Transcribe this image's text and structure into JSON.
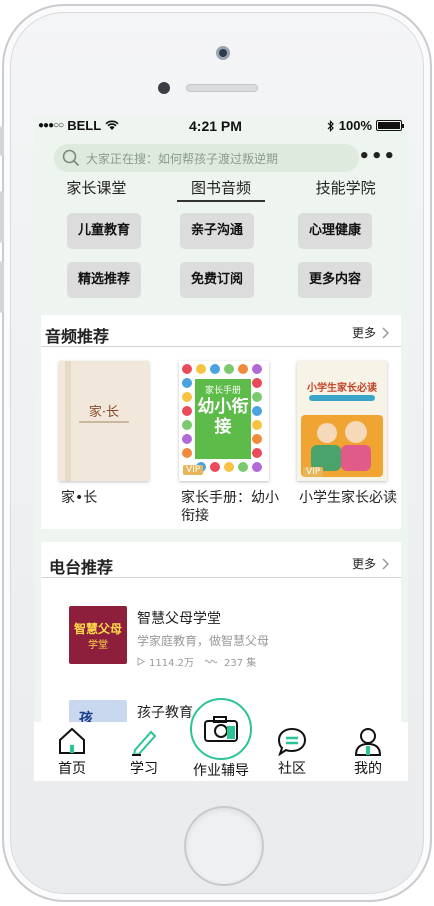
{
  "status_bar": {
    "carrier": "BELL",
    "time": "4:21 PM",
    "battery": "100%"
  },
  "search": {
    "placeholder": "大家正在搜：如何帮孩子渡过叛逆期"
  },
  "top_tabs": [
    {
      "label": "家长课堂",
      "active": false
    },
    {
      "label": "图书音频",
      "active": true
    },
    {
      "label": "技能学院",
      "active": false
    }
  ],
  "categories": [
    "儿童教育",
    "亲子沟通",
    "心理健康",
    "精选推荐",
    "免费订阅",
    "更多内容"
  ],
  "audio_section": {
    "title": "音频推荐",
    "more_label": "更多",
    "books": [
      {
        "title": "家•长",
        "cover_text": "家·长",
        "vip": false
      },
      {
        "title": "家长手册：幼小衔接",
        "cover_text_top": "家长手册",
        "cover_text_main": "幼小衔接",
        "vip": true,
        "vip_label": "VIP"
      },
      {
        "title": "小学生家长必读",
        "cover_text": "小学生家长必读",
        "vip": true,
        "vip_label": "VIP"
      }
    ]
  },
  "radio_section": {
    "title": "电台推荐",
    "more_label": "更多",
    "items": [
      {
        "title": "智慧父母学堂",
        "subtitle": "学家庭教育，做智慧父母",
        "plays": "1114.2万",
        "episodes": "237 集",
        "thumb_text": "智慧父母",
        "thumb_sub": "学堂"
      },
      {
        "title": "孩子教育",
        "subtitle": "",
        "plays": "",
        "episodes": "",
        "thumb_text": "孩"
      }
    ]
  },
  "bottom_nav": [
    {
      "label": "首页",
      "icon": "home-icon"
    },
    {
      "label": "学习",
      "icon": "pen-icon"
    },
    {
      "label": "作业辅导",
      "icon": "camera-icon"
    },
    {
      "label": "社区",
      "icon": "chat-icon"
    },
    {
      "label": "我的",
      "icon": "user-icon"
    }
  ],
  "colors": {
    "accent": "#2bc497",
    "screen_bg": "#eef4ef",
    "button_bg": "#dcdcdc"
  }
}
